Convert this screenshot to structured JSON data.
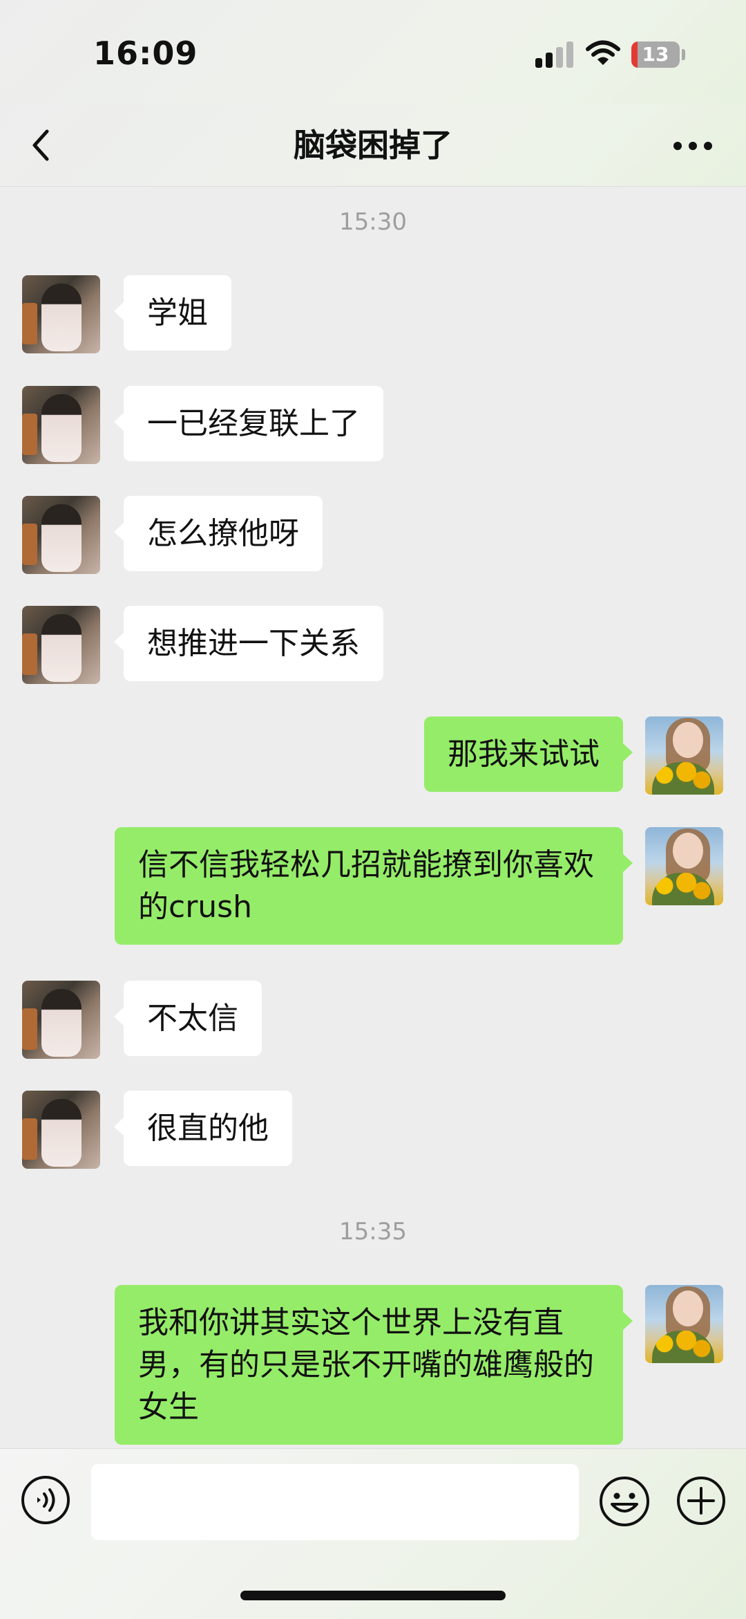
{
  "status_bar": {
    "time": "16:09",
    "battery_level": "13",
    "icons": [
      "signal-icon",
      "wifi-icon",
      "battery-icon"
    ]
  },
  "nav": {
    "title": "脑袋困掉了",
    "back_icon": "chevron-left-icon",
    "more_icon": "ellipsis-icon"
  },
  "chat": {
    "timestamps": [
      "15:30",
      "15:35"
    ],
    "messages": [
      {
        "side": "left",
        "text": "学姐"
      },
      {
        "side": "left",
        "text": "一已经复联上了"
      },
      {
        "side": "left",
        "text": "怎么撩他呀"
      },
      {
        "side": "left",
        "text": "想推进一下关系"
      },
      {
        "side": "right",
        "text": "那我来试试"
      },
      {
        "side": "right",
        "text": "信不信我轻松几招就能撩到你喜欢的crush"
      },
      {
        "side": "left",
        "text": "不太信"
      },
      {
        "side": "left",
        "text": "很直的他"
      },
      {
        "side": "right",
        "text": "我和你讲其实这个世界上没有直男，有的只是张不开嘴的雄鹰般的女生"
      }
    ]
  },
  "input_bar": {
    "text_value": "",
    "icons": [
      "voice-icon",
      "emoji-icon",
      "plus-icon"
    ]
  },
  "colors": {
    "sent_bubble": "#95ec69",
    "received_bubble": "#ffffff",
    "background": "#ededed",
    "battery_low": "#e53935"
  }
}
